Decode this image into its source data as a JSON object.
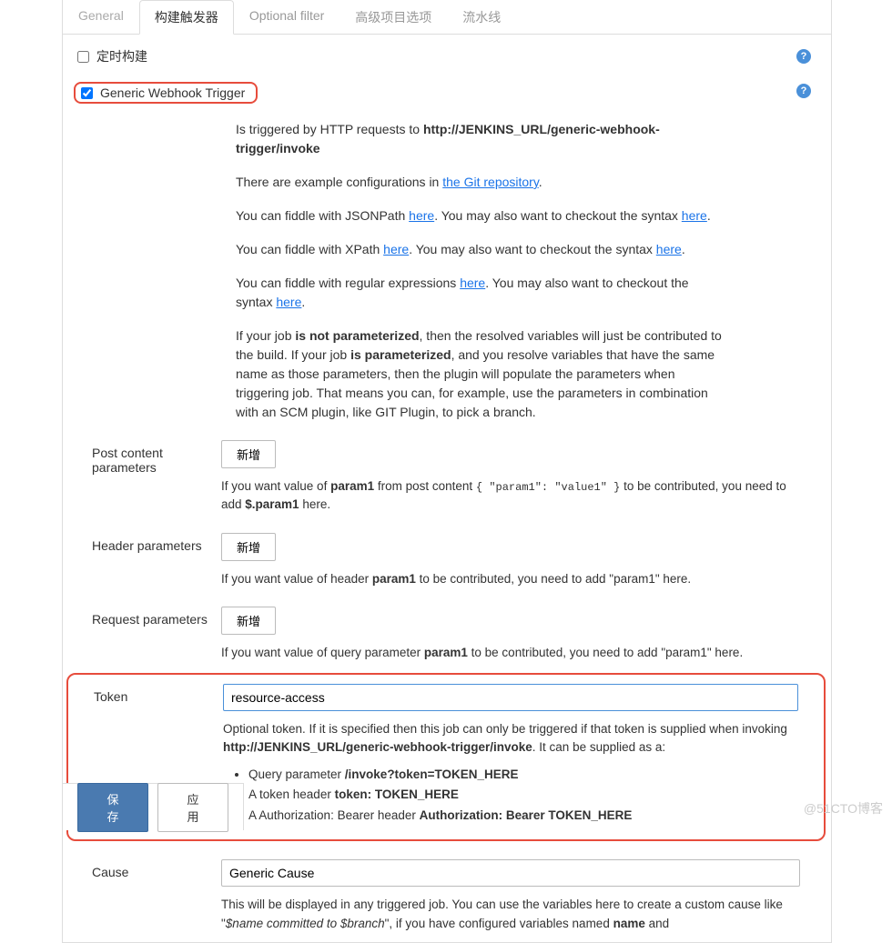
{
  "tabs": [
    "General",
    "构建触发器",
    "Optional filter",
    "高级项目选项",
    "流水线"
  ],
  "active_tab": 1,
  "checkboxes": {
    "scheduled": {
      "label": "定时构建",
      "checked": false
    },
    "webhook": {
      "label": "Generic Webhook Trigger",
      "checked": true
    }
  },
  "desc": {
    "line1_pre": "Is triggered by HTTP requests to ",
    "line1_bold": "http://JENKINS_URL/generic-webhook-trigger/invoke",
    "conf_pre": "There are example configurations in ",
    "conf_link": "the Git repository",
    "jsonpath": {
      "pre": "You can fiddle with JSONPath ",
      "link": "here",
      "mid": ". You may also want to checkout the syntax ",
      "link2": "here",
      "post": "."
    },
    "xpath": {
      "pre": "You can fiddle with XPath ",
      "link": "here",
      "mid": ". You may also want to checkout the syntax ",
      "link2": "here",
      "post": "."
    },
    "regex": {
      "pre": "You can fiddle with regular expressions ",
      "link": "here",
      "mid": ". You may also want to checkout the syntax ",
      "link2": "here",
      "post": "."
    },
    "param": {
      "p1": "If your job ",
      "b1": "is not parameterized",
      "p2": ", then the resolved variables will just be contributed to the build. If your job ",
      "b2": "is parameterized",
      "p3": ", and you resolve variables that have the same name as those parameters, then the plugin will populate the parameters when triggering job. That means you can, for example, use the parameters in combination with an SCM plugin, like GIT Plugin, to pick a branch."
    }
  },
  "post_params": {
    "label": "Post content parameters",
    "add": "新增",
    "hint_pre": "If you want value of ",
    "hint_b1": "param1",
    "hint_mid": " from post content ",
    "hint_code": "{ \"param1\": \"value1\" }",
    "hint_mid2": " to be contributed, you need to add ",
    "hint_b2": "$.param1",
    "hint_post": " here."
  },
  "header_params": {
    "label": "Header parameters",
    "add": "新增",
    "hint_pre": "If you want value of header ",
    "hint_b": "param1",
    "hint_post": " to be contributed, you need to add \"param1\" here."
  },
  "request_params": {
    "label": "Request parameters",
    "add": "新增",
    "hint_pre": "If you want value of query parameter ",
    "hint_b": "param1",
    "hint_post": " to be contributed, you need to add \"param1\" here."
  },
  "token": {
    "label": "Token",
    "value": "resource-access",
    "hint_pre": "Optional token. If it is specified then this job can only be triggered if that token is supplied when invoking ",
    "hint_b": "http://JENKINS_URL/generic-webhook-trigger/invoke",
    "hint_post": ". It can be supplied as a:",
    "bullets": {
      "q_pre": "Query parameter ",
      "q_b": "/invoke?token=TOKEN_HERE",
      "t_pre": "A token header ",
      "t_b": "token: TOKEN_HERE",
      "a_pre": "A Authorization: Bearer header ",
      "a_b": "Authorization: Bearer TOKEN_HERE"
    }
  },
  "cause": {
    "label": "Cause",
    "value": "Generic Cause",
    "hint_pre": "This will be displayed in any triggered job. You can use the variables here to create a custom cause like \"",
    "hint_i": "$name committed to $branch",
    "hint_mid": "\", if you have configured variables named ",
    "hint_b": "name",
    "hint_post_partial": " and "
  },
  "buttons": {
    "save": "保存",
    "apply": "应用"
  },
  "watermark": "@51CTO博客"
}
